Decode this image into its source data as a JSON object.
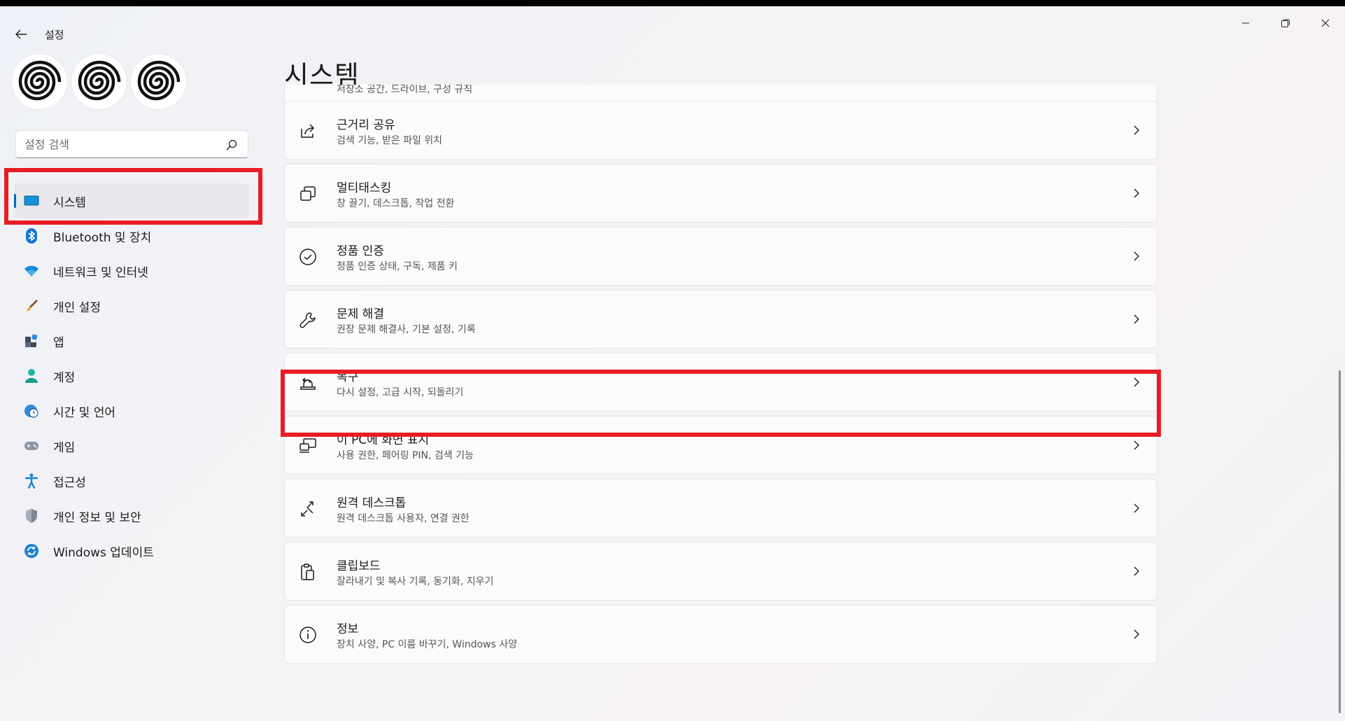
{
  "window": {
    "title": "설정",
    "controls": [
      "minimize",
      "restore",
      "close"
    ]
  },
  "search": {
    "placeholder": "설정 검색"
  },
  "sidebar": {
    "items": [
      {
        "label": "시스템",
        "icon": "system-icon",
        "active": true
      },
      {
        "label": "Bluetooth 및 장치",
        "icon": "bluetooth-icon"
      },
      {
        "label": "네트워크 및 인터넷",
        "icon": "wifi-icon"
      },
      {
        "label": "개인 설정",
        "icon": "brush-icon"
      },
      {
        "label": "앱",
        "icon": "apps-icon"
      },
      {
        "label": "계정",
        "icon": "person-icon"
      },
      {
        "label": "시간 및 언어",
        "icon": "globe-clock-icon"
      },
      {
        "label": "게임",
        "icon": "gamepad-icon"
      },
      {
        "label": "접근성",
        "icon": "accessibility-icon"
      },
      {
        "label": "개인 정보 및 보안",
        "icon": "shield-icon"
      },
      {
        "label": "Windows 업데이트",
        "icon": "update-icon"
      }
    ]
  },
  "main": {
    "title": "시스템",
    "partial_item_sub": "저장소 공간, 드라이브, 구성 규칙",
    "items": [
      {
        "title": "근거리 공유",
        "sub": "검색 기능, 받은 파일 위치",
        "icon": "share-icon"
      },
      {
        "title": "멀티태스킹",
        "sub": "창 끌기, 데스크톱, 작업 전환",
        "icon": "multitask-icon"
      },
      {
        "title": "정품 인증",
        "sub": "정품 인증 상태, 구독, 제품 키",
        "icon": "check-circle-icon"
      },
      {
        "title": "문제 해결",
        "sub": "권장 문제 해결사, 기본 설정, 기록",
        "icon": "wrench-icon"
      },
      {
        "title": "복구",
        "sub": "다시 설정, 고급 시작, 되돌리기",
        "icon": "recovery-icon"
      },
      {
        "title": "이 PC에 화면 표시",
        "sub": "사용 권한, 페어링 PIN, 검색 기능",
        "icon": "project-icon"
      },
      {
        "title": "원격 데스크톱",
        "sub": "원격 데스크톱 사용자, 연결 권한",
        "icon": "remote-desktop-icon"
      },
      {
        "title": "클립보드",
        "sub": "잘라내기 및 복사 기록, 동기화, 지우기",
        "icon": "clipboard-icon"
      },
      {
        "title": "정보",
        "sub": "장치 사양, PC 이름 바꾸기, Windows 사양",
        "icon": "info-icon"
      }
    ]
  },
  "colors": {
    "accent": "#0067c0",
    "highlight": "#e81c24"
  }
}
